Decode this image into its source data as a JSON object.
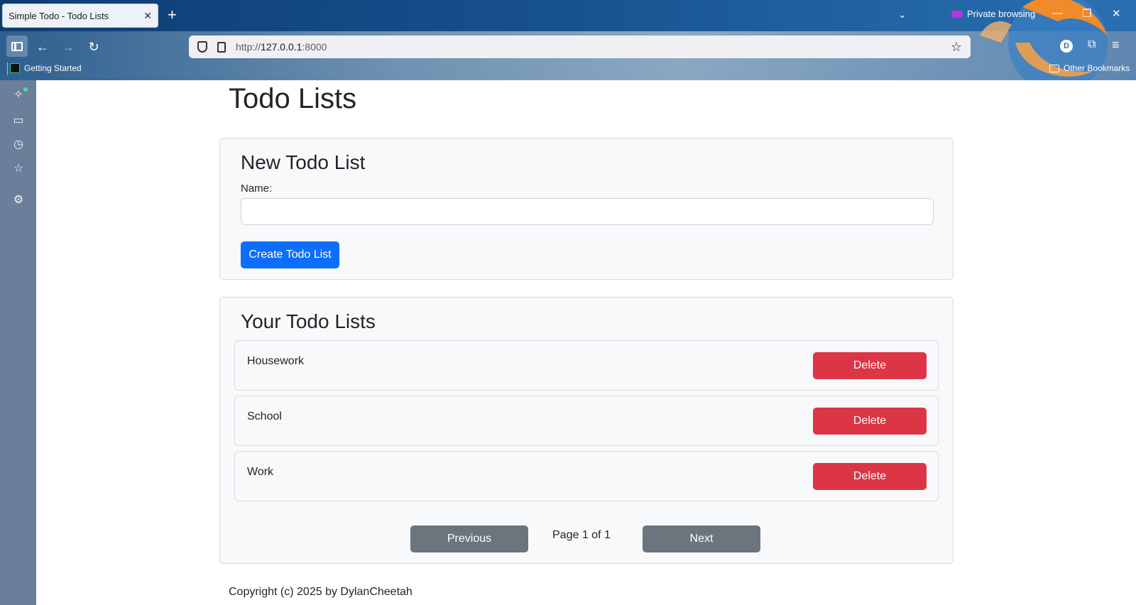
{
  "browser": {
    "tab_title": "Simple Todo - Todo Lists",
    "tab_close": "✕",
    "new_tab": "+",
    "private_label": "Private browsing",
    "url_prefix": "http://",
    "url_host": "127.0.0.1",
    "url_port": ":8000",
    "profile_initial": "D",
    "bookmark_getting_started": "Getting Started",
    "bookmark_other": "Other Bookmarks",
    "accent": "#0d3d72"
  },
  "page": {
    "title": "Todo Lists",
    "new_card": {
      "heading": "New Todo List",
      "name_label": "Name:",
      "name_value": "",
      "create_label": "Create Todo List"
    },
    "lists_card": {
      "heading": "Your Todo Lists",
      "items": [
        {
          "name": "Housework",
          "delete_label": "Delete"
        },
        {
          "name": "School",
          "delete_label": "Delete"
        },
        {
          "name": "Work",
          "delete_label": "Delete"
        }
      ],
      "previous_label": "Previous",
      "next_label": "Next",
      "page_info": "Page 1 of 1"
    },
    "copyright": "Copyright (c) 2025 by DylanCheetah"
  },
  "colors": {
    "primary": "#0d6efd",
    "danger": "#dc3545",
    "secondary": "#6c757d"
  }
}
